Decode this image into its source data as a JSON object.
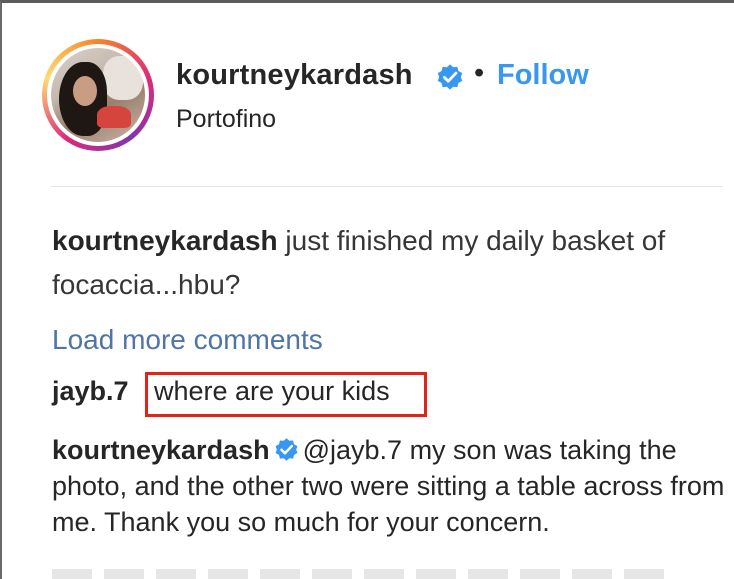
{
  "post": {
    "username": "kourtneykardash",
    "separator": "•",
    "follow_label": "Follow",
    "location": "Portofino",
    "verified_icon": "verified-badge-icon",
    "accent_color": "#3897f0"
  },
  "caption": {
    "author": "kourtneykardash",
    "text": " just finished my daily basket of focaccia...hbu?"
  },
  "comments": {
    "load_more_label": "Load more comments",
    "items": [
      {
        "author": "jayb.7",
        "text": "where are your kids",
        "highlight_color": "#e2231a"
      },
      {
        "author": "kourtneykardash",
        "mention": "@jayb.7",
        "text": " my son was taking the photo, and the other two were sitting a table across from me. Thank you so much for your concern."
      }
    ]
  }
}
